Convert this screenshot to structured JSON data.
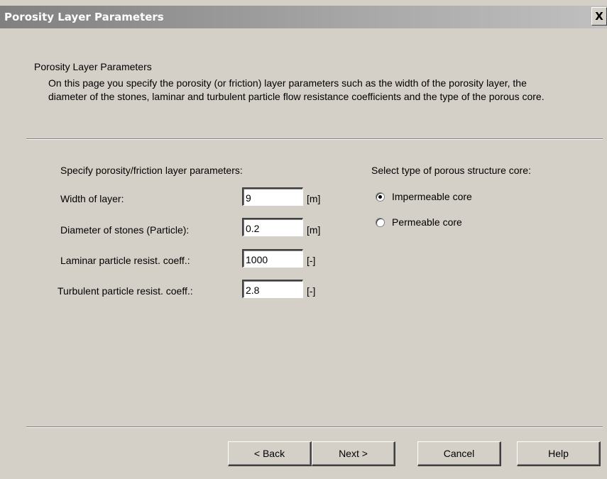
{
  "window": {
    "title": "Porosity Layer Parameters",
    "close_label": "X"
  },
  "header": {
    "title": "Porosity Layer Parameters",
    "description": "On this page you specify the porosity (or friction) layer parameters such as the width of the porosity layer, the diameter of the stones, laminar and turbulent particle flow resistance coefficients and the type of the  porous core."
  },
  "params": {
    "section_label": "Specify porosity/friction layer parameters:",
    "fields": [
      {
        "label": "Width of layer:",
        "value": "9",
        "unit": "[m]"
      },
      {
        "label": "Diameter of stones (Particle):",
        "value": "0.2",
        "unit": "[m]"
      },
      {
        "label": "Laminar particle resist. coeff.:",
        "value": "1000",
        "unit": "[-]"
      },
      {
        "label": "Turbulent particle resist. coeff.:",
        "value": "2.8",
        "unit": "[-]"
      }
    ]
  },
  "core": {
    "section_label": "Select type of porous structure core:",
    "options": [
      {
        "label": "Impermeable core",
        "selected": true
      },
      {
        "label": "Permeable core",
        "selected": false
      }
    ]
  },
  "buttons": {
    "back": "< Back",
    "next": "Next >",
    "cancel": "Cancel",
    "help": "Help"
  }
}
